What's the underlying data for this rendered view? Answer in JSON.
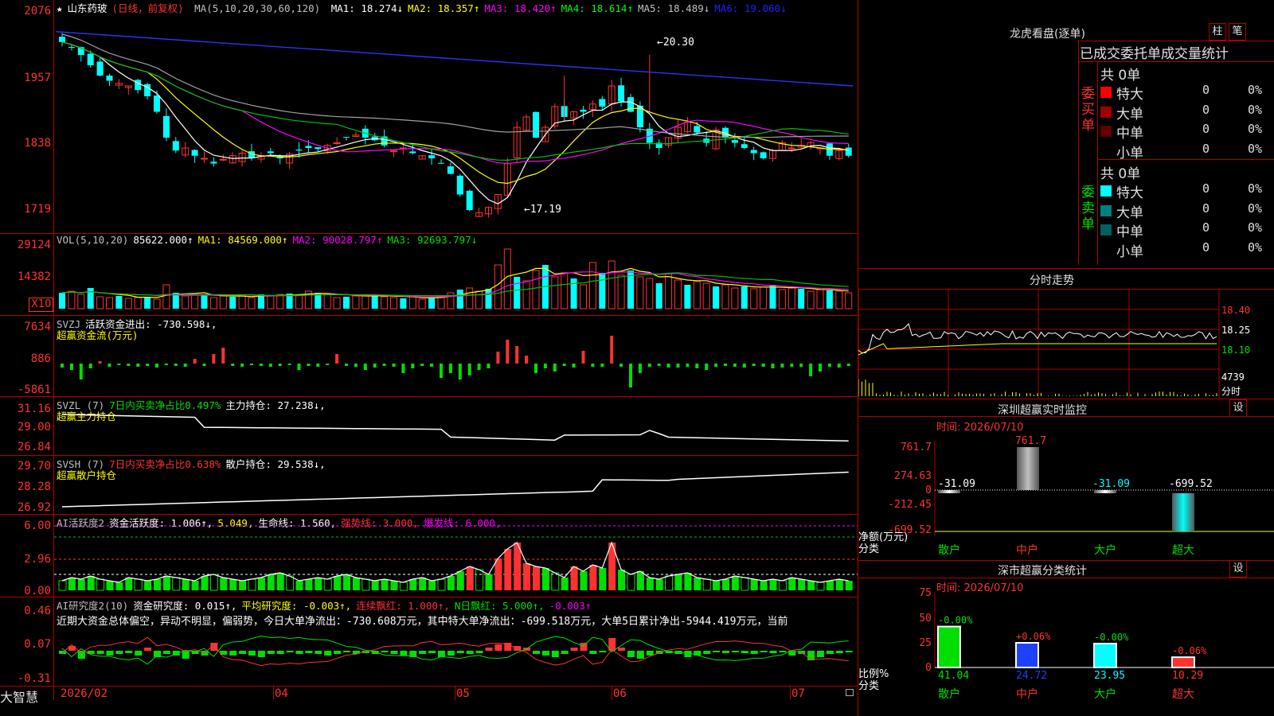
{
  "stock": {
    "name": "山东药玻",
    "period": "(日线，前复权)",
    "star": "★"
  },
  "ma": {
    "label": "MA(5,10,20,30,60,120)",
    "items": [
      {
        "name": "MA1:",
        "value": "18.274↓",
        "color": "#ffffff"
      },
      {
        "name": "MA2:",
        "value": "18.357↑",
        "color": "#ffff00"
      },
      {
        "name": "MA3:",
        "value": "18.420↑",
        "color": "#ff00ff"
      },
      {
        "name": "MA4:",
        "value": "18.614↑",
        "color": "#00ff00"
      },
      {
        "name": "MA5:",
        "value": "18.489↓",
        "color": "#c0c0c0"
      },
      {
        "name": "MA6:",
        "value": "19.060↓",
        "color": "#2020ff"
      }
    ]
  },
  "price_axis": [
    "2076",
    "1957",
    "1838",
    "1719"
  ],
  "price_annotations": {
    "high": "20.30",
    "low": "17.19"
  },
  "vol": {
    "label": "VOL(5,10,20)",
    "value": "85622.000↑",
    "ma1": "MA1: 84569.000↑",
    "ma2": "MA2: 90028.797↑",
    "ma3": "MA3: 92693.797↓",
    "axis": [
      "29124",
      "14382"
    ],
    "unit": "X10"
  },
  "svzj": {
    "label": "SVZJ",
    "title": "活跃资金进出: -730.598↓,",
    "subtitle": "超赢资金流(万元)",
    "axis": [
      "7634",
      "886",
      "-5861"
    ]
  },
  "svzl": {
    "label": "SVZL (7)",
    "t1": "7日内买卖净占比0.497%",
    "t2": "主力持仓: 27.238↓,",
    "subtitle": "超赢主力持仓",
    "axis": [
      "31.16",
      "29.00",
      "26.84"
    ]
  },
  "svsh": {
    "label": "SVSH (7)",
    "t1": "7日内买卖净占比0.638%",
    "t2": "散户持仓: 29.538↓,",
    "subtitle": "超赢散户持仓",
    "axis": [
      "29.70",
      "28.28",
      "26.92"
    ]
  },
  "ai_active": {
    "label": "AI活跃度2",
    "t1": "资金活跃度: 1.006↑,",
    "t2": "5.049,",
    "t3": "生命线: 1.560,",
    "t4": "强势线: 3.000,",
    "t5": "爆发线: 6.000,",
    "axis": [
      "6.00",
      "2.96",
      "0.00"
    ]
  },
  "ai_research": {
    "label": "AI研究度2(10)",
    "t1": "资金研究度: 0.015↑,",
    "t2": "平均研究度: -0.003↑,",
    "t3": "连续飘红: 1.000↑,",
    "t4": "N日飘红: 5.000↑,",
    "t5": "-0.003↑",
    "comment": "近期大资金总体偏空，异动不明显，偏弱势，今日大单净流出：-730.608万元，其中特大单净流出：-699.518万元，大单5日累计净出-5944.419万元，当前",
    "axis": [
      "0.46",
      "0.07",
      "-0.31"
    ]
  },
  "date_axis": [
    "2026/02",
    "04",
    "05",
    "06",
    "07"
  ],
  "brand": "大智慧",
  "right": {
    "lhb_title": "龙虎看盘(逐单)",
    "btn_zhu": "柱",
    "btn_bi": "笔",
    "tabs": "已成交委托单成交量统计",
    "buy_label": "委买单",
    "sell_label": "委卖单",
    "buy_total": "共 0单",
    "sell_total": "共 0单",
    "buy_rows": [
      {
        "label": "特大",
        "count": "0",
        "pct": "0%",
        "color": "#ff0000"
      },
      {
        "label": "大单",
        "count": "0",
        "pct": "0%",
        "color": "#a00000"
      },
      {
        "label": "中单",
        "count": "0",
        "pct": "0%",
        "color": "#600000"
      },
      {
        "label": "小单",
        "count": "0",
        "pct": "0%",
        "color": ""
      }
    ],
    "sell_rows": [
      {
        "label": "特大",
        "count": "0",
        "pct": "0%",
        "color": "#00ffff"
      },
      {
        "label": "大单",
        "count": "0",
        "pct": "0%",
        "color": "#008080"
      },
      {
        "label": "中单",
        "count": "0",
        "pct": "0%",
        "color": "#006060"
      },
      {
        "label": "小单",
        "count": "0",
        "pct": "0%",
        "color": ""
      }
    ],
    "intraday_title": "分时走势",
    "intraday_axis": [
      "18.40",
      "18.25",
      "18.10",
      "4739",
      "分时"
    ],
    "monitor_title": "深圳超赢实时监控",
    "monitor_btn": "设",
    "monitor_time": "时间: 2026/07/10",
    "monitor_axis": [
      "761.7",
      "274.63",
      "0",
      "-212.45",
      "-699.52"
    ],
    "monitor_yunit": "净额(万元)",
    "monitor_xunit": "分类",
    "monitor_cats": [
      "散户",
      "中户",
      "大户",
      "超大"
    ],
    "monitor_values": [
      "-31.09",
      "761.7",
      "-31.09",
      "-699.52"
    ],
    "class_title": "深市超赢分类统计",
    "class_btn": "设",
    "class_time": "时间: 2026/07/10",
    "class_axis": [
      "75",
      "50",
      "25",
      "0"
    ],
    "class_yunit": "比例%",
    "class_xunit": "分类",
    "class_cats": [
      "散户",
      "中户",
      "大户",
      "超大"
    ],
    "class_changes": [
      "-0.00%",
      "+0.06%",
      "-0.00%",
      "-0.06%"
    ],
    "class_values": [
      "41.04",
      "24.72",
      "23.95",
      "10.29"
    ]
  }
}
